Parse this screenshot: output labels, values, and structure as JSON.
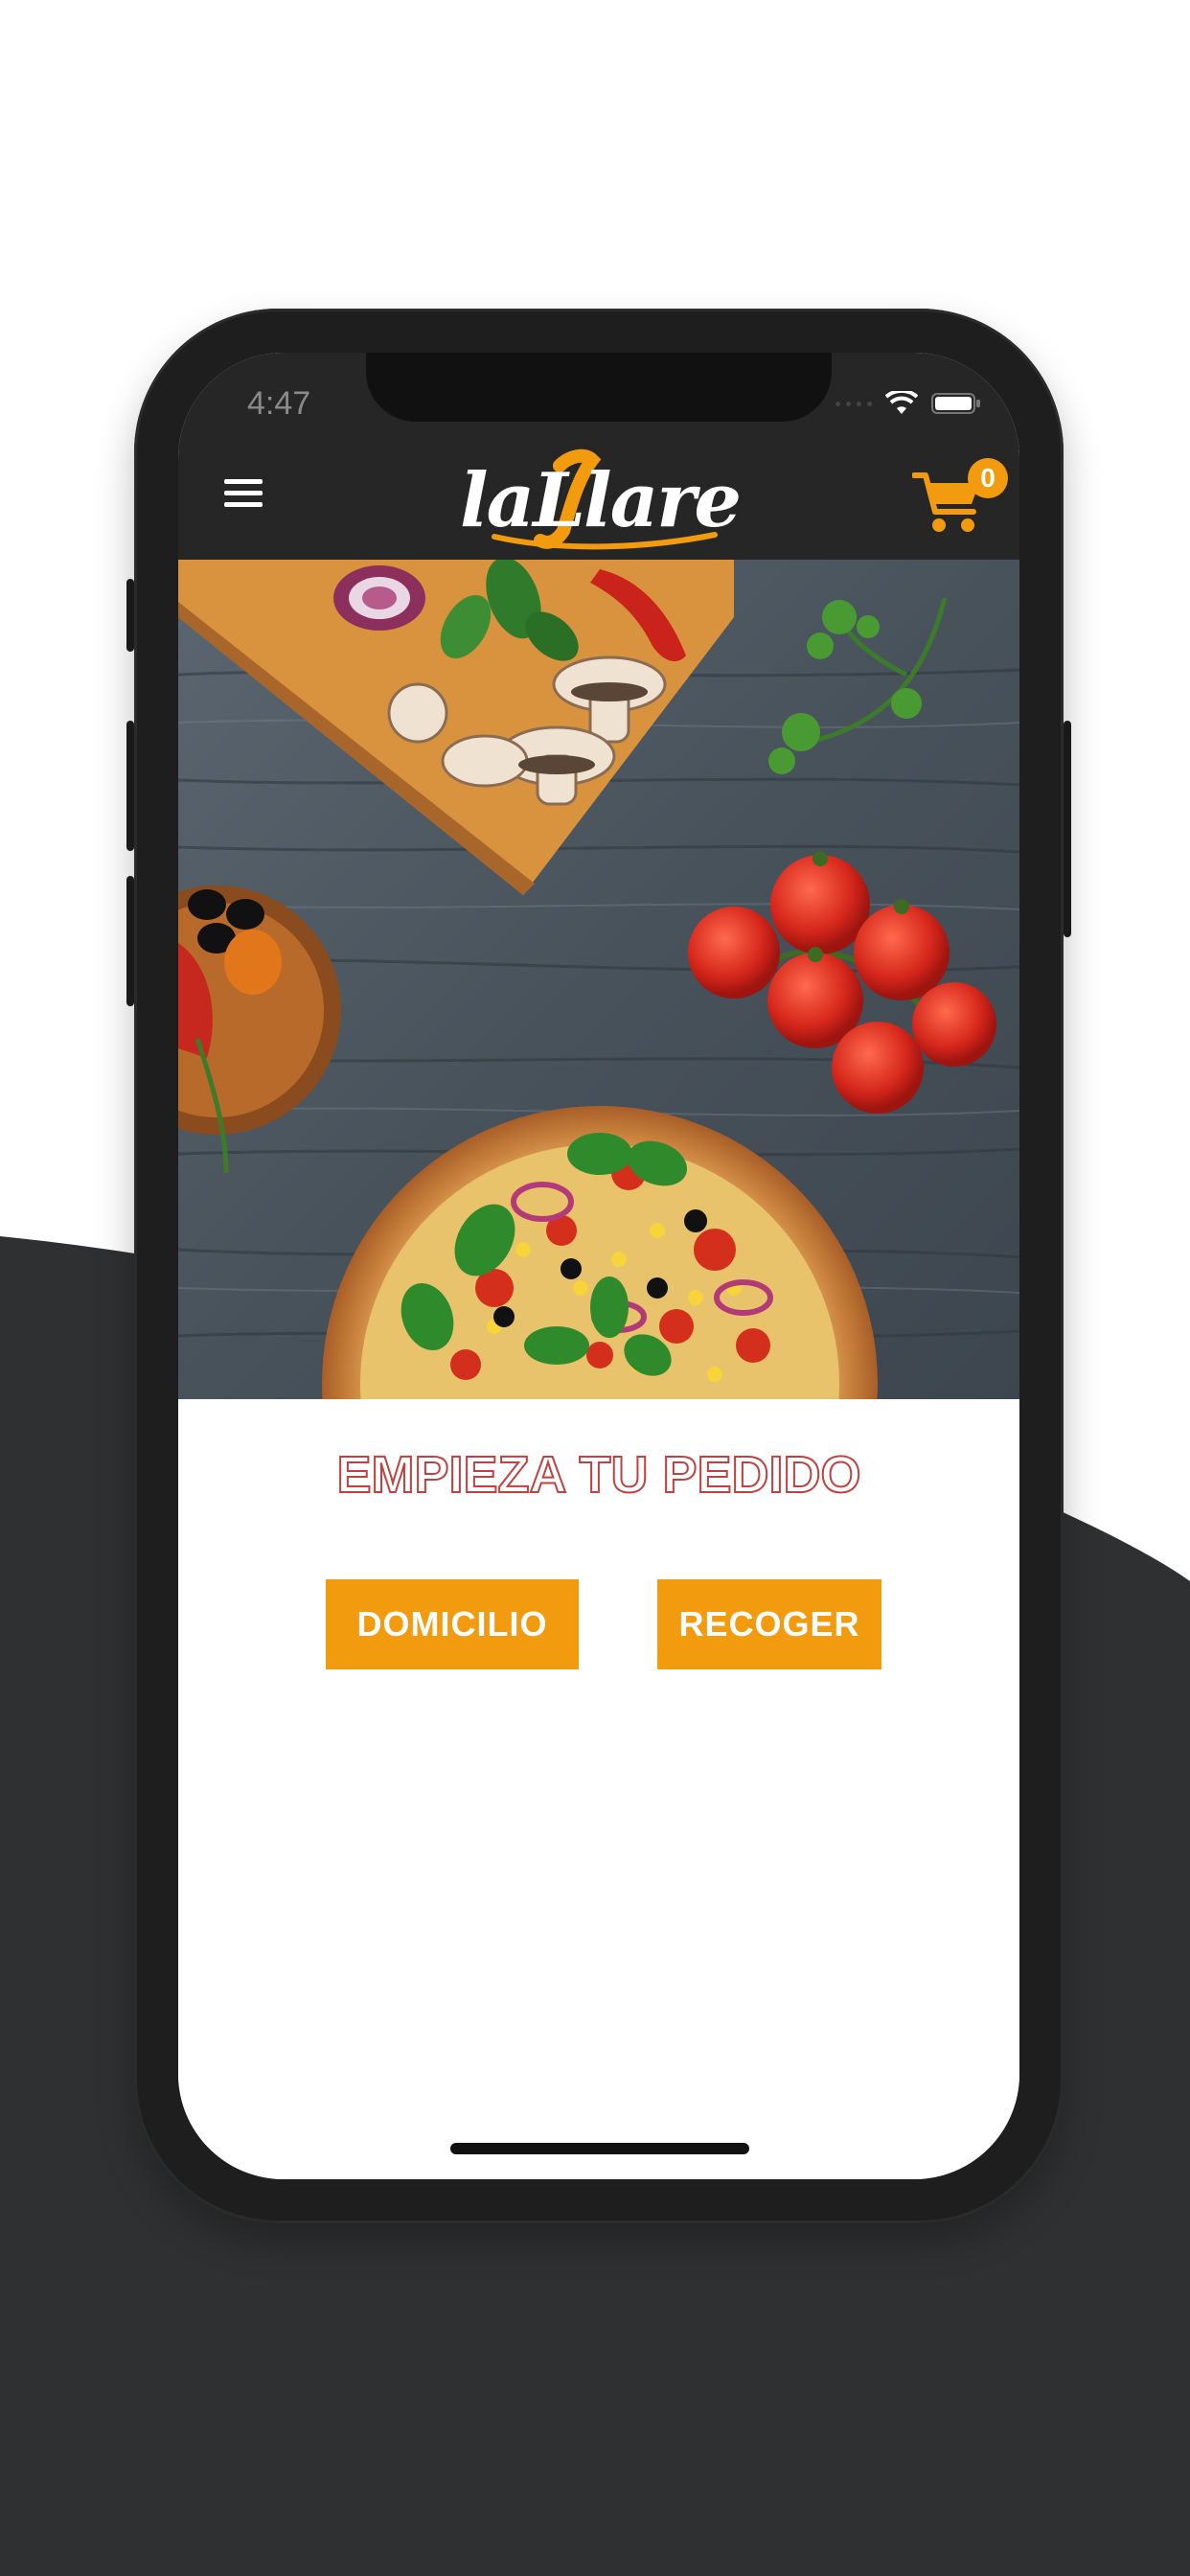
{
  "status_bar": {
    "time": "4:47",
    "icons": [
      "signal-dots-icon",
      "wifi-icon",
      "battery-icon"
    ]
  },
  "header": {
    "menu_icon": "hamburger-menu-icon",
    "logo_text": "laLlare",
    "cart_icon": "shopping-cart-icon",
    "cart_count": "0"
  },
  "hero": {
    "image": "pizza-ingredients-photo"
  },
  "order": {
    "headline": "EMPIEZA TU PEDIDO",
    "delivery_label": "DOMICILIO",
    "pickup_label": "RECOGER"
  },
  "colors": {
    "accent": "#f29b0f",
    "header_bg": "#262626",
    "headline_outline": "#c0413f",
    "backdrop_dark": "#2f3031"
  }
}
